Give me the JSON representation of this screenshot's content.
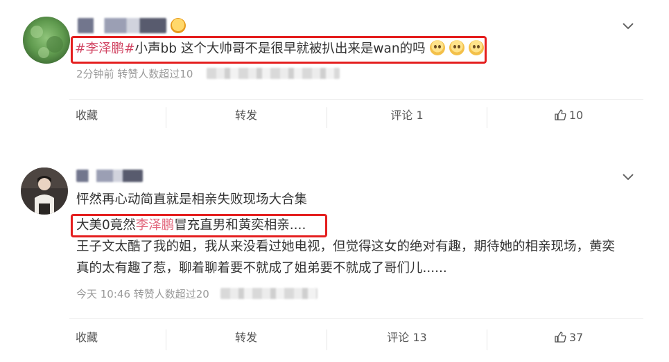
{
  "posts": [
    {
      "content_segments": [
        {
          "text": "#李泽鹏#",
          "style": "tag"
        },
        {
          "text": "小声bb 这个大帅哥不是很早就被扒出来是wan的吗",
          "style": "normal"
        }
      ],
      "emojis": [
        "thinking-face-icon",
        "thinking-face-icon",
        "thinking-face-icon"
      ],
      "meta": "2分钟前 转赞人数超过10",
      "actions": {
        "collect": "收藏",
        "repost": "转发",
        "comment": "评论 1",
        "like": "10"
      }
    },
    {
      "lines": [
        "怦然再心动简直就是相亲失败现场大合集",
        "王子文太酷了我的姐，我从来没看过她电视，但觉得这女的绝对有趣，期待她的相亲现场，黄奕",
        "真的太有趣了惹，聊着聊着要不就成了姐弟要不就成了哥们儿......"
      ],
      "highlight_segments": [
        {
          "text": "大美0竟然",
          "style": "normal"
        },
        {
          "text": "李泽鹏",
          "style": "pink"
        },
        {
          "text": "冒充直男和黄奕相亲....",
          "style": "normal"
        }
      ],
      "meta": "今天 10:46 转赞人数超过20",
      "actions": {
        "collect": "收藏",
        "repost": "转发",
        "comment": "评论 13",
        "like": "37"
      }
    }
  ],
  "colors": {
    "highlight_box": "#e41e1e",
    "topic_link": "#d14361",
    "meta_text": "#9a9a9a"
  }
}
